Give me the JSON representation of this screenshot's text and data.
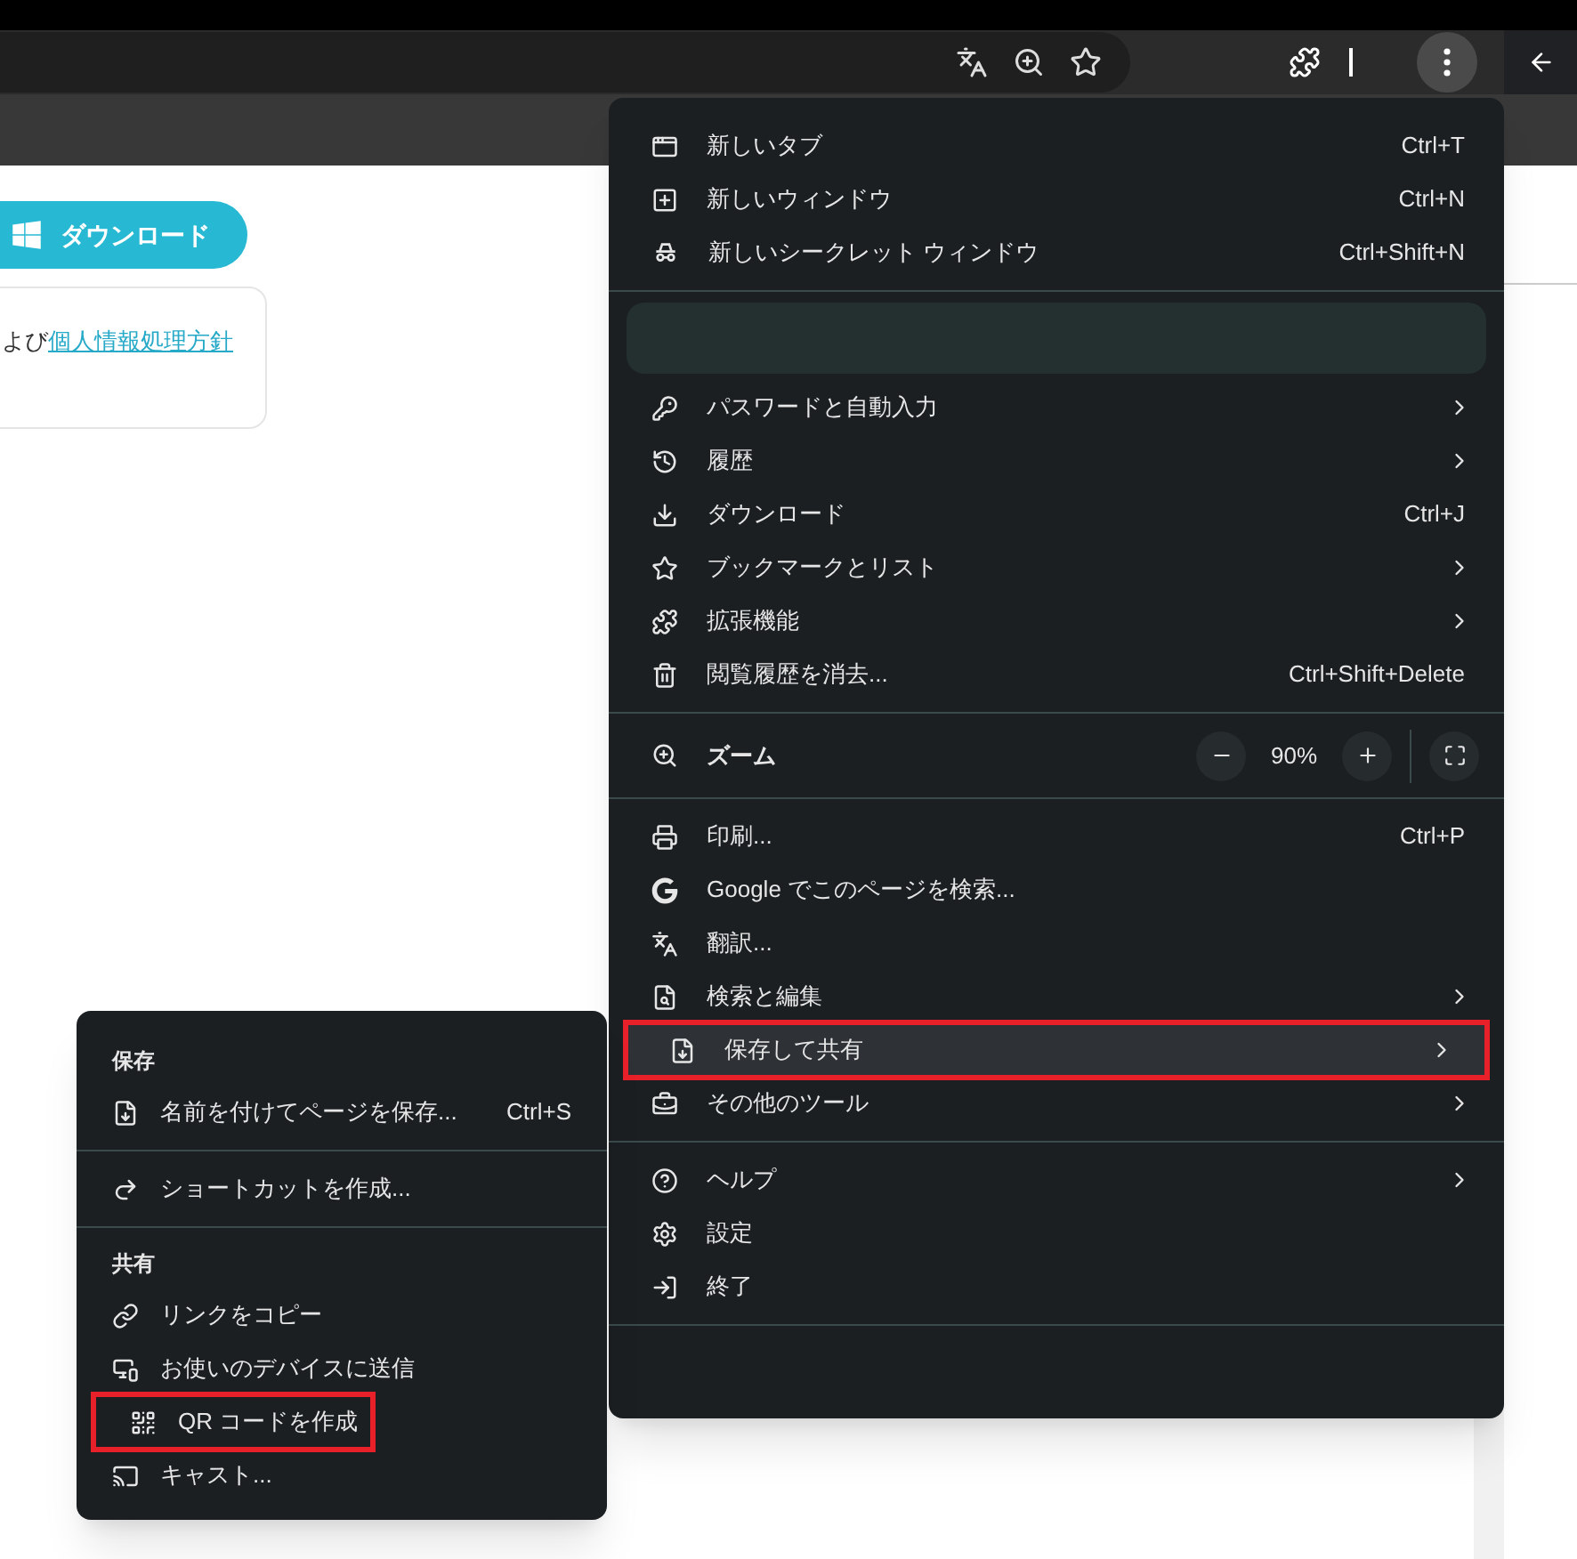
{
  "page": {
    "download_button": "ダウンロード",
    "notice": {
      "text": "よび",
      "link": "個人情報処理方針"
    }
  },
  "main_menu": {
    "groups": [
      {
        "kind": "items",
        "items": [
          {
            "kind": "item",
            "label": "新しいタブ",
            "shortcut": "Ctrl+T",
            "submenu": false,
            "selected": false,
            "outlined": false
          },
          {
            "kind": "item",
            "label": "新しいウィンドウ",
            "shortcut": "Ctrl+N",
            "submenu": false,
            "selected": false,
            "outlined": false
          },
          {
            "kind": "item",
            "label": "新しいシークレット ウィンドウ",
            "shortcut": "Ctrl+Shift+N",
            "submenu": false,
            "selected": false,
            "outlined": false
          }
        ]
      },
      {
        "kind": "items",
        "items": [
          {
            "kind": "profile"
          },
          {
            "kind": "item",
            "label": "パスワードと自動入力",
            "submenu": true,
            "selected": false,
            "outlined": false
          },
          {
            "kind": "item",
            "label": "履歴",
            "submenu": true,
            "selected": false,
            "outlined": false
          },
          {
            "kind": "item",
            "label": "ダウンロード",
            "shortcut": "Ctrl+J",
            "submenu": false,
            "selected": false,
            "outlined": false
          },
          {
            "kind": "item",
            "label": "ブックマークとリスト",
            "submenu": true,
            "selected": false,
            "outlined": false
          },
          {
            "kind": "item",
            "label": "拡張機能",
            "submenu": true,
            "selected": false,
            "outlined": false
          },
          {
            "kind": "item",
            "label": "閲覧履歴を消去...",
            "shortcut": "Ctrl+Shift+Delete",
            "submenu": false,
            "selected": false,
            "outlined": false
          }
        ]
      },
      {
        "kind": "zoom",
        "label": "ズーム",
        "value": "90%"
      },
      {
        "kind": "items",
        "items": [
          {
            "kind": "item",
            "label": "印刷...",
            "shortcut": "Ctrl+P",
            "submenu": false,
            "selected": false,
            "outlined": false
          },
          {
            "kind": "item",
            "label": "Google でこのページを検索...",
            "submenu": false,
            "selected": false,
            "outlined": false
          },
          {
            "kind": "item",
            "label": "翻訳...",
            "submenu": false,
            "selected": false,
            "outlined": false
          },
          {
            "kind": "item",
            "label": "検索と編集",
            "submenu": true,
            "selected": false,
            "outlined": false
          },
          {
            "kind": "item",
            "label": "保存して共有",
            "submenu": true,
            "selected": true,
            "outlined": true
          },
          {
            "kind": "item",
            "label": "その他のツール",
            "submenu": true,
            "selected": false,
            "outlined": false
          }
        ]
      },
      {
        "kind": "items",
        "items": [
          {
            "kind": "item",
            "label": "ヘルプ",
            "submenu": true,
            "selected": false,
            "outlined": false
          },
          {
            "kind": "item",
            "label": "設定",
            "submenu": false,
            "selected": false,
            "outlined": false
          },
          {
            "kind": "item",
            "label": "終了",
            "submenu": false,
            "selected": false,
            "outlined": false
          }
        ]
      },
      {
        "kind": "empty"
      }
    ]
  },
  "submenu": {
    "sections": [
      {
        "header": "保存",
        "items": [
          {
            "label": "名前を付けてページを保存...",
            "shortcut": "Ctrl+S",
            "outlined": false
          }
        ]
      },
      {
        "items": [
          {
            "label": "ショートカットを作成...",
            "outlined": false
          }
        ]
      },
      {
        "header": "共有",
        "items": [
          {
            "label": "リンクをコピー",
            "outlined": false
          },
          {
            "label": "お使いのデバイスに送信",
            "outlined": false
          },
          {
            "label": "QR コードを作成",
            "outlined": true
          },
          {
            "label": "キャスト...",
            "outlined": false
          }
        ]
      }
    ]
  }
}
